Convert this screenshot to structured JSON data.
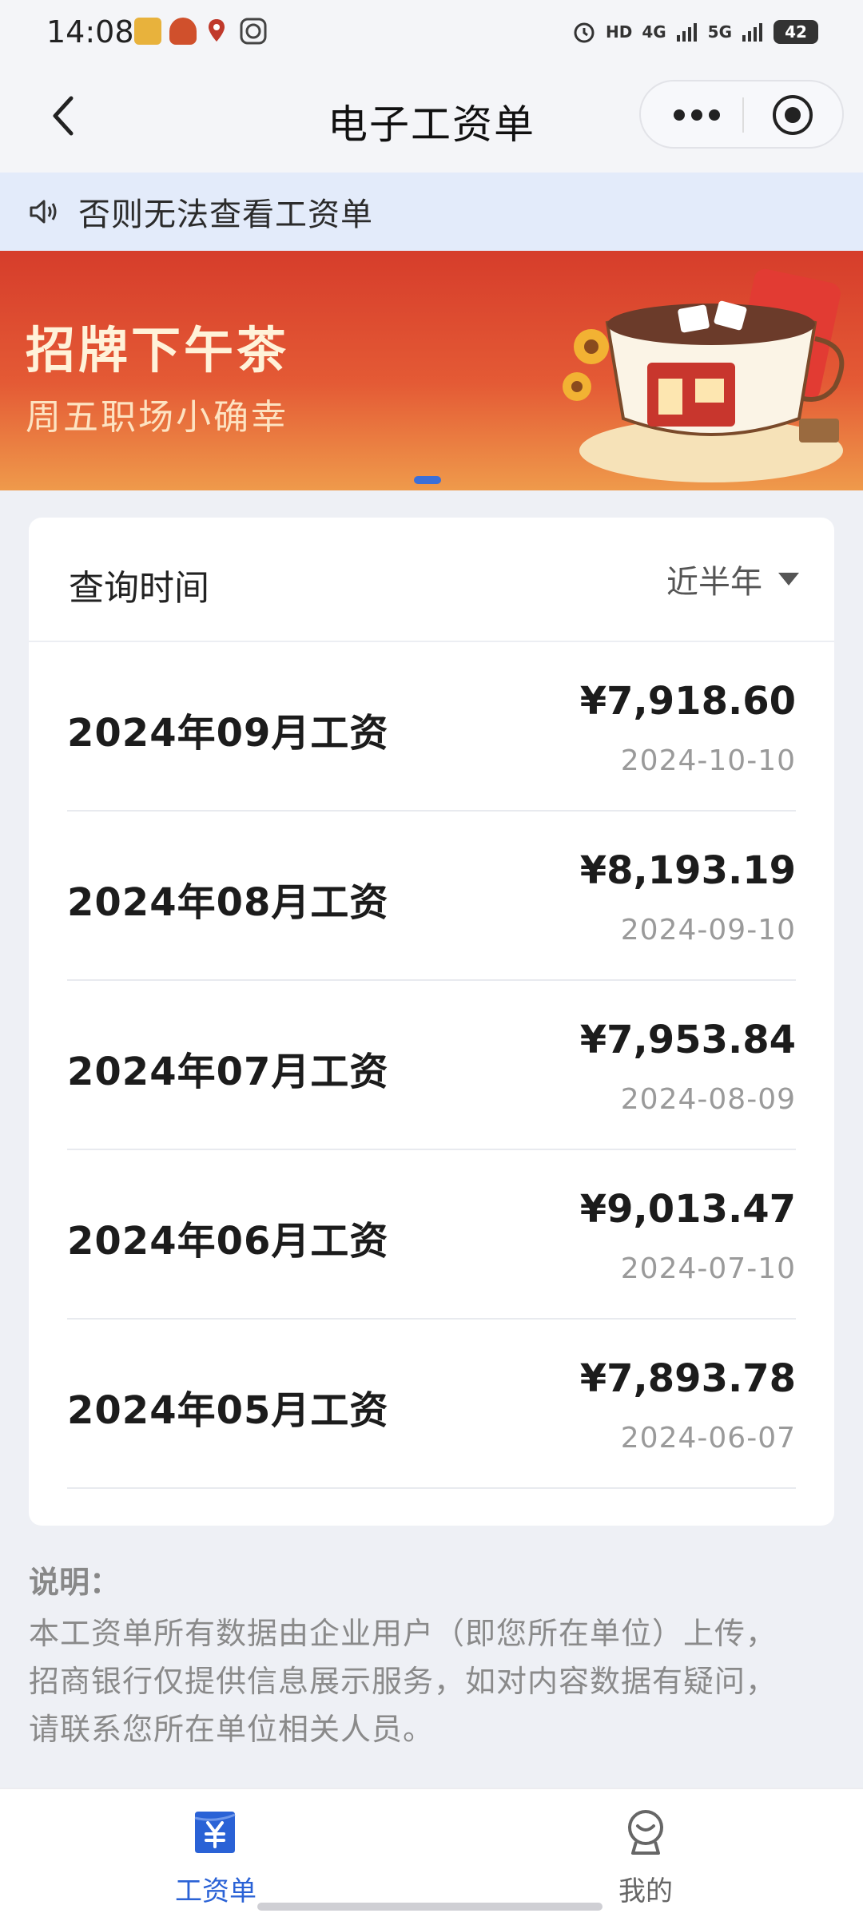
{
  "status_bar": {
    "time": "14:08",
    "indicators": [
      "HD",
      "4G",
      "5G"
    ],
    "battery": "42"
  },
  "nav": {
    "title": "电子工资单",
    "back_icon": "chevron-left-icon",
    "more_icon": "more-dots-icon",
    "close_icon": "target-close-icon"
  },
  "notice": {
    "icon": "speaker-icon",
    "text": "否则无法查看工资单"
  },
  "banner": {
    "title": "招牌下午茶",
    "subtitle": "周五职场小确幸"
  },
  "query": {
    "label": "查询时间",
    "selected": "近半年"
  },
  "salaries": [
    {
      "name": "2024年09月工资",
      "amount": "¥7,918.60",
      "date": "2024-10-10"
    },
    {
      "name": "2024年08月工资",
      "amount": "¥8,193.19",
      "date": "2024-09-10"
    },
    {
      "name": "2024年07月工资",
      "amount": "¥7,953.84",
      "date": "2024-08-09"
    },
    {
      "name": "2024年06月工资",
      "amount": "¥9,013.47",
      "date": "2024-07-10"
    },
    {
      "name": "2024年05月工资",
      "amount": "¥7,893.78",
      "date": "2024-06-07"
    }
  ],
  "note": {
    "title": "说明：",
    "lines": [
      "本工资单所有数据由企业用户（即您所在单位）上传，",
      "招商银行仅提供信息展示服务，如对内容数据有疑问，",
      "请联系您所在单位相关人员。"
    ]
  },
  "tabs": [
    {
      "label": "工资单",
      "icon": "payslip-icon",
      "active": true
    },
    {
      "label": "我的",
      "icon": "profile-icon",
      "active": false
    }
  ],
  "colors": {
    "accent": "#2a62d6",
    "notice_bg": "#e3ebfa",
    "banner_red": "#d63d2b"
  }
}
